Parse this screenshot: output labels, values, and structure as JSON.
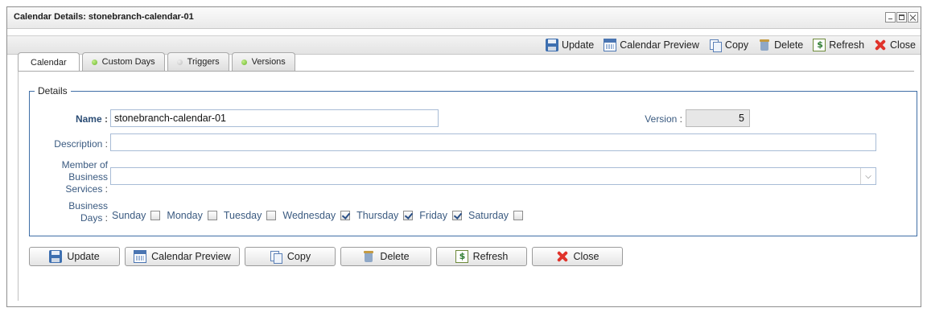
{
  "window": {
    "title": "Calendar Details: stonebranch-calendar-01"
  },
  "toolbar": {
    "items": [
      {
        "label": "Update",
        "icon": "save-icon"
      },
      {
        "label": "Calendar Preview",
        "icon": "calendar-icon"
      },
      {
        "label": "Copy",
        "icon": "copy-icon"
      },
      {
        "label": "Delete",
        "icon": "delete-icon"
      },
      {
        "label": "Refresh",
        "icon": "refresh-icon"
      },
      {
        "label": "Close",
        "icon": "close-icon"
      }
    ]
  },
  "tabs": [
    {
      "label": "Calendar",
      "active": true
    },
    {
      "label": "Custom Days",
      "status": "green"
    },
    {
      "label": "Triggers",
      "status": "grey"
    },
    {
      "label": "Versions",
      "status": "green"
    }
  ],
  "details": {
    "legend": "Details",
    "name_label": "Name",
    "name_value": "stonebranch-calendar-01",
    "version_label": "Version",
    "version_value": "5",
    "description_label": "Description",
    "description_value": "",
    "member_label_1": "Member of",
    "member_label_2": "Business",
    "member_label_3": "Services",
    "member_value": "",
    "business_days_label_1": "Business",
    "business_days_label_2": "Days",
    "days": [
      {
        "label": "Sunday",
        "checked": false
      },
      {
        "label": "Monday",
        "checked": false
      },
      {
        "label": "Tuesday",
        "checked": false
      },
      {
        "label": "Wednesday",
        "checked": true
      },
      {
        "label": "Thursday",
        "checked": true
      },
      {
        "label": "Friday",
        "checked": true
      },
      {
        "label": "Saturday",
        "checked": false
      }
    ]
  },
  "buttons": {
    "update": "Update",
    "calendar_preview": "Calendar Preview",
    "copy": "Copy",
    "delete": "Delete",
    "refresh": "Refresh",
    "close": "Close"
  },
  "colors": {
    "fieldset_border": "#3f6ea6",
    "label_text": "#3a5a80",
    "status_green": "#69b42c",
    "status_grey": "#bdbdbd",
    "close_red": "#e0332b"
  }
}
